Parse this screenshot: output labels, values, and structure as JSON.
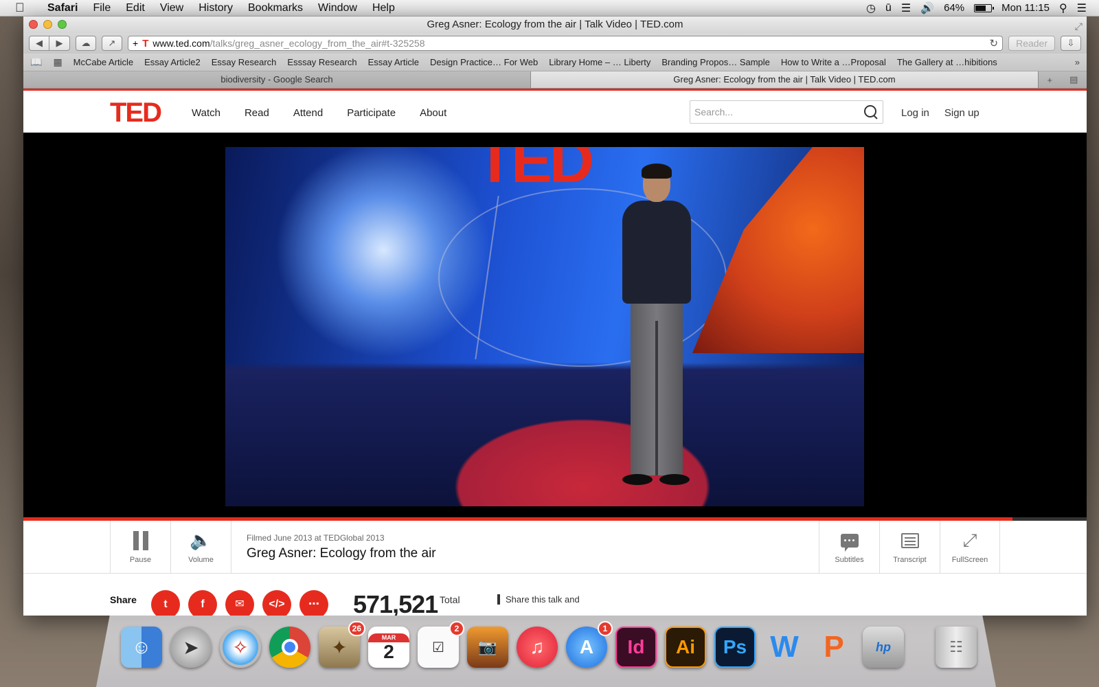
{
  "menubar": {
    "app": "Safari",
    "items": [
      "File",
      "Edit",
      "View",
      "History",
      "Bookmarks",
      "Window",
      "Help"
    ],
    "battery": "64%",
    "clock": "Mon 11:15"
  },
  "window": {
    "title": "Greg Asner: Ecology from the air | Talk Video | TED.com"
  },
  "toolbar": {
    "url_host": "www.ted.com",
    "url_path": "/talks/greg_asner_ecology_from_the_air#t-325258",
    "reader": "Reader"
  },
  "bookmarks": [
    "McCabe Article",
    "Essay Article2",
    "Essay Research",
    "Esssay Research",
    "Essay Article",
    "Design Practice… For Web",
    "Library Home – … Liberty",
    "Branding Propos… Sample",
    "How to Write a …Proposal",
    "The Gallery at …hibitions"
  ],
  "tabs": [
    {
      "label": "biodiversity - Google Search",
      "active": false
    },
    {
      "label": "Greg Asner: Ecology from the air | Talk Video | TED.com",
      "active": true
    }
  ],
  "ted": {
    "logo": "TED",
    "nav": [
      "Watch",
      "Read",
      "Attend",
      "Participate",
      "About"
    ],
    "search_placeholder": "Search...",
    "login": "Log in",
    "signup": "Sign up",
    "brand_color": "#e62b1e"
  },
  "player": {
    "stage_logo": "TED",
    "progress": 0.93
  },
  "controls": {
    "pause": "Pause",
    "volume": "Volume",
    "filmed": "Filmed June 2013 at TEDGlobal 2013",
    "title": "Greg Asner: Ecology from the air",
    "subtitles": "Subtitles",
    "transcript": "Transcript",
    "fullscreen": "FullScreen"
  },
  "share": {
    "label": "Share",
    "icons": [
      "twitter-icon",
      "facebook-icon",
      "email-icon",
      "embed-icon",
      "more-icon"
    ],
    "views": "571,521",
    "views_label": "Total",
    "cta": "Share this talk and"
  },
  "dock": {
    "apps": [
      {
        "name": "Finder",
        "icon": "finder-icon"
      },
      {
        "name": "Launchpad",
        "icon": "launchpad-icon"
      },
      {
        "name": "Safari",
        "icon": "safari-icon"
      },
      {
        "name": "Chrome",
        "icon": "chrome-icon"
      },
      {
        "name": "Mail",
        "icon": "mail-icon",
        "badge": "26"
      },
      {
        "name": "Calendar",
        "icon": "calendar-icon",
        "month": "MAR",
        "day": "2"
      },
      {
        "name": "Reminders",
        "icon": "reminders-icon",
        "badge": "2"
      },
      {
        "name": "iPhoto",
        "icon": "iphoto-icon"
      },
      {
        "name": "iTunes",
        "icon": "itunes-icon"
      },
      {
        "name": "App Store",
        "icon": "app-store-icon",
        "badge": "1"
      },
      {
        "name": "InDesign",
        "icon": "indesign-icon",
        "text": "Id"
      },
      {
        "name": "Illustrator",
        "icon": "illustrator-icon",
        "text": "Ai"
      },
      {
        "name": "Photoshop",
        "icon": "photoshop-icon",
        "text": "Ps"
      },
      {
        "name": "Word",
        "icon": "word-icon",
        "text": "W"
      },
      {
        "name": "PowerPoint",
        "icon": "powerpoint-icon",
        "text": "P"
      },
      {
        "name": "HP Utility",
        "icon": "hp-icon",
        "text": "hp"
      },
      {
        "name": "Trash",
        "icon": "trash-icon"
      }
    ]
  }
}
